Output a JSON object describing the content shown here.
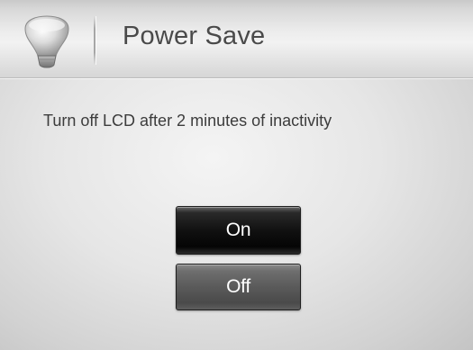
{
  "header": {
    "title": "Power Save",
    "icon": "lamp-icon"
  },
  "message": "Turn off LCD after 2 minutes of inactivity",
  "buttons": {
    "on_label": "On",
    "off_label": "Off",
    "selected": "On"
  },
  "colors": {
    "selected_button": "#111111",
    "unselected_button": "#5a5a5a"
  }
}
